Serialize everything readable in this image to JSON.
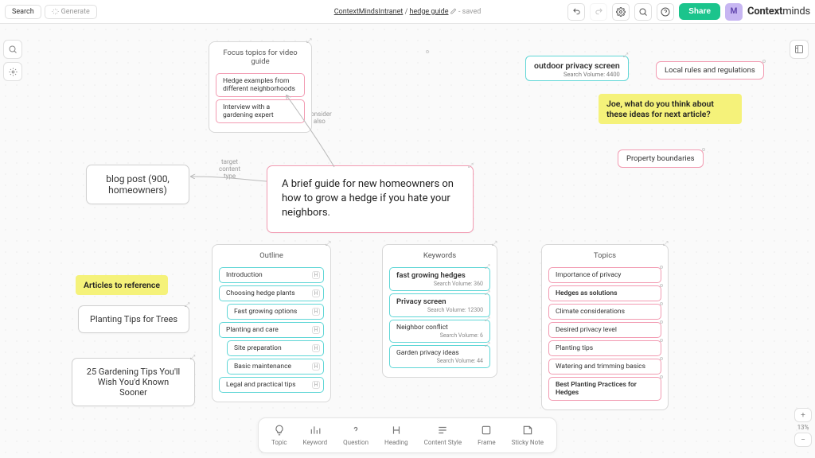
{
  "header": {
    "search": "Search",
    "generate": "Generate",
    "breadcrumb_root": "ContextMindsIntranet",
    "breadcrumb_map": "hedge guide",
    "saved_status": "saved",
    "share": "Share",
    "avatar_initial": "M",
    "brand_context": "Context",
    "brand_minds": "minds"
  },
  "zoom": {
    "percent": "13%"
  },
  "edge_labels": {
    "consider_also": "consider\nalso",
    "target_content_type": "target\ncontent\ntype"
  },
  "nodes": {
    "center_brief": "A brief guide for new homeowners on how to grow a hedge if you hate your neighbors.",
    "blog_post": "blog post (900, homeowners)",
    "outdoor_privacy": {
      "title": "outdoor privacy screen",
      "vol": "Search Volume: 4400"
    },
    "local_rules": "Local rules and regulations",
    "property_bounds": "Property boundaries",
    "joe_note": "Joe, what do you think about these ideas for next article?",
    "articles_ref": "Articles to reference",
    "planting_tips_trees": "Planting Tips for Trees",
    "gardening_25": "25 Gardening Tips You'll Wish You'd Known Sooner"
  },
  "focus_frame": {
    "title": "Focus topics for video guide",
    "items": [
      "Hedge examples from different neighborhoods",
      "Interview with a gardening expert"
    ]
  },
  "outline": {
    "title": "Outline",
    "items": [
      {
        "t": "Introduction",
        "badge": "H",
        "indent": false,
        "c": "teal"
      },
      {
        "t": "Choosing hedge plants",
        "badge": "H",
        "indent": false,
        "c": "teal"
      },
      {
        "t": "Fast growing options",
        "badge": "H",
        "indent": true,
        "c": "teal"
      },
      {
        "t": "Planting and care",
        "badge": "H",
        "indent": false,
        "c": "teal"
      },
      {
        "t": "Site preparation",
        "badge": "H",
        "indent": true,
        "c": "teal"
      },
      {
        "t": "Basic maintenance",
        "badge": "H",
        "indent": true,
        "c": "teal"
      },
      {
        "t": "Legal and practical tips",
        "badge": "H",
        "indent": false,
        "c": "teal"
      }
    ]
  },
  "keywords": {
    "title": "Keywords",
    "items": [
      {
        "t": "fast growing hedges",
        "sub": "Search Volume: 360",
        "bold": true
      },
      {
        "t": "Privacy screen",
        "sub": "Search Volume: 12300",
        "bold": true
      },
      {
        "t": "Neighbor conflict",
        "sub": "Search Volume: 6",
        "bold": false
      },
      {
        "t": "Garden privacy ideas",
        "sub": "Search Volume: 44",
        "bold": false
      }
    ]
  },
  "topics": {
    "title": "Topics",
    "items": [
      {
        "t": "Importance of privacy",
        "c": "pink"
      },
      {
        "t": "Hedges as solutions",
        "c": "pink",
        "bold": true
      },
      {
        "t": "Climate considerations",
        "c": "pink"
      },
      {
        "t": "Desired privacy level",
        "c": "pink"
      },
      {
        "t": "Planting tips",
        "c": "pink"
      },
      {
        "t": "Watering and trimming basics",
        "c": "pink"
      },
      {
        "t": "Best Planting Practices for Hedges",
        "c": "pink",
        "bold": true
      }
    ]
  },
  "bottom_tools": [
    {
      "k": "topic",
      "label": "Topic"
    },
    {
      "k": "keyword",
      "label": "Keyword"
    },
    {
      "k": "question",
      "label": "Question"
    },
    {
      "k": "heading",
      "label": "Heading"
    },
    {
      "k": "content-style",
      "label": "Content Style"
    },
    {
      "k": "frame",
      "label": "Frame"
    },
    {
      "k": "sticky-note",
      "label": "Sticky Note"
    }
  ]
}
